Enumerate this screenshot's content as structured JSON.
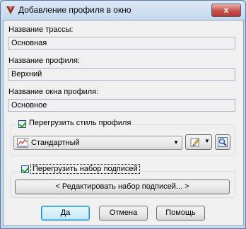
{
  "window": {
    "title": "Добавление профиля в окно",
    "close_glyph": "x"
  },
  "fields": {
    "route_label": "Название трассы:",
    "route_value": "Основная",
    "profile_label": "Название профиля:",
    "profile_value": "Верхний",
    "view_label": "Название окна профиля:",
    "view_value": "Основное"
  },
  "style_group": {
    "checkbox_label": "Перегрузить стиль профиля",
    "checked": true,
    "style_value": "Стандартный"
  },
  "labels_group": {
    "checkbox_label": "Перегрузить набор подписей",
    "checked": true,
    "edit_button": "< Редактировать набор подписей... >"
  },
  "buttons": {
    "ok": "Да",
    "cancel": "Отмена",
    "help": "Помощь"
  },
  "colors": {
    "accent": "#3c7fb1",
    "checkmark": "#21a121",
    "title_bar": "#c5d8ee"
  }
}
